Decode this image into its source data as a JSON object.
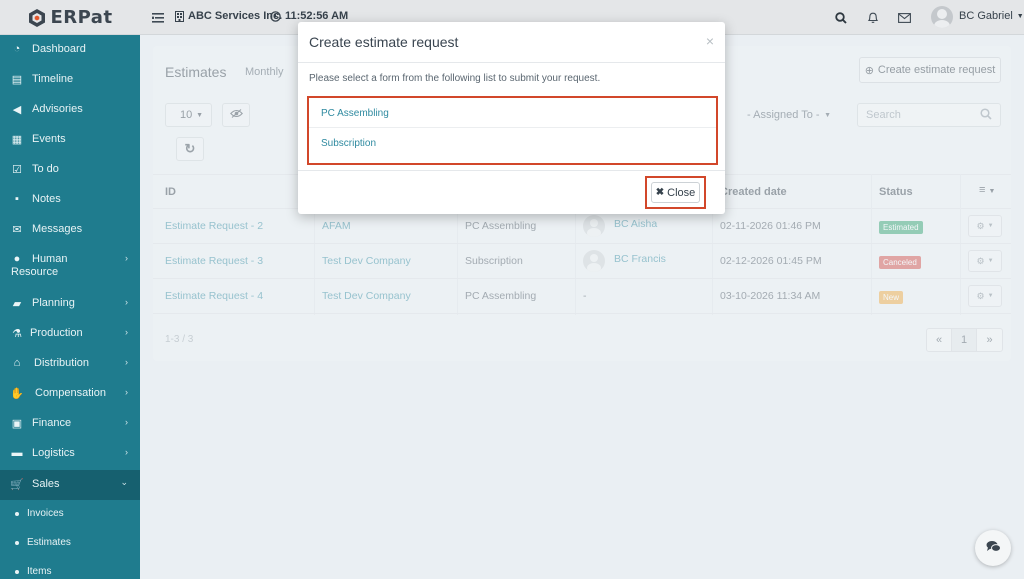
{
  "app": {
    "logo_text": "ERPat",
    "company": "ABC Services Inc.",
    "clock": "11:52:56 AM",
    "user_name": "BC Gabriel"
  },
  "sidebar": {
    "items": [
      {
        "label": "Dashboard",
        "icon": "dashboard-icon"
      },
      {
        "label": "Timeline",
        "icon": "timeline-icon"
      },
      {
        "label": "Advisories",
        "icon": "megaphone-icon"
      },
      {
        "label": "Events",
        "icon": "calendar-icon"
      },
      {
        "label": "To do",
        "icon": "checkbox-icon"
      },
      {
        "label": "Notes",
        "icon": "note-icon"
      },
      {
        "label": "Messages",
        "icon": "envelope-icon"
      },
      {
        "label": "Human Resource",
        "icon": "users-icon"
      },
      {
        "label": "Planning",
        "icon": "briefcase-icon"
      },
      {
        "label": "Production",
        "icon": "flask-icon"
      },
      {
        "label": "Distribution",
        "icon": "bank-icon"
      },
      {
        "label": "Compensation",
        "icon": "handshake-icon"
      },
      {
        "label": "Finance",
        "icon": "money-icon"
      },
      {
        "label": "Logistics",
        "icon": "truck-icon"
      },
      {
        "label": "Sales",
        "icon": "cart-icon"
      }
    ],
    "sales_sub": [
      "Invoices",
      "Estimates",
      "Items"
    ]
  },
  "page": {
    "title": "Estimates",
    "tab": "Monthly",
    "create_button": "Create estimate request",
    "page_size": "10",
    "assigned_filter": "- Assigned To -",
    "search_placeholder": "Search",
    "columns": {
      "id": "ID",
      "created": "Created date",
      "status": "Status"
    },
    "rows": [
      {
        "id": "Estimate Request - 2",
        "client": "AFAM",
        "form": "PC Assembling",
        "assignee": "BC Aisha",
        "date": "02-11-2026 01:46 PM",
        "status": "Estimated",
        "status_color": "#2aa06a"
      },
      {
        "id": "Estimate Request - 3",
        "client": "Test Dev Company",
        "form": "Subscription",
        "assignee": "BC Francis",
        "date": "02-12-2026 01:45 PM",
        "status": "Canceled",
        "status_color": "#d24b44"
      },
      {
        "id": "Estimate Request - 4",
        "client": "Test Dev Company",
        "form": "PC Assembling",
        "assignee": "-",
        "date": "03-10-2026 11:34 AM",
        "status": "New",
        "status_color": "#f0a63a"
      }
    ],
    "pager_info": "1-3 / 3",
    "pager": {
      "prev": "«",
      "current": "1",
      "next": "»"
    }
  },
  "modal": {
    "title": "Create estimate request",
    "description": "Please select a form from the following list to submit your request.",
    "forms": [
      "PC Assembling",
      "Subscription"
    ],
    "close_label": "Close",
    "x_glyph": "×"
  },
  "colors": {
    "sidebar": "#1f7c8e",
    "accent_link": "#2f8aa0",
    "highlight": "#d2472a"
  }
}
